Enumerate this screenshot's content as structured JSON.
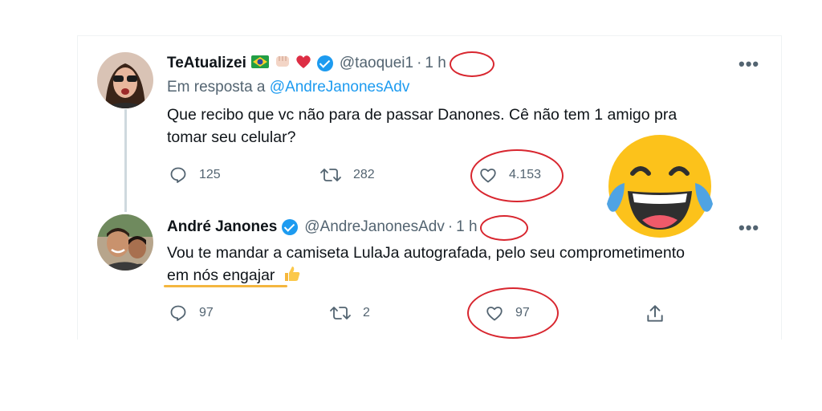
{
  "tweet1": {
    "name": "TeAtualizei",
    "handle": "@taoquei1",
    "time": "1 h",
    "reply_prefix": "Em resposta a",
    "reply_to": "@AndreJanonesAdv",
    "text_line1": "Que recibo que vc não para de passar Danones. Cê não tem 1 amigo pra",
    "text_line2": "tomar seu celular?",
    "replies": "125",
    "retweets": "282",
    "likes": "4.153"
  },
  "tweet2": {
    "name": "André Janones",
    "handle": "@AndreJanonesAdv",
    "time": "1 h",
    "text_line1": "Vou te mandar a camiseta LulaJa autografada, pelo seu comprometimento",
    "text_line2": "em nós engajar",
    "replies": "97",
    "retweets": "2",
    "likes": "97"
  },
  "more_label": "•••",
  "icons": [
    "reply-icon",
    "retweet-icon",
    "like-icon",
    "share-icon",
    "verified-icon",
    "brazil-flag-icon",
    "fist-icon",
    "heart-icon",
    "thumbs-up-icon",
    "laughing-crying-emoji"
  ],
  "colors": {
    "accent": "#1d9bf0",
    "annotation_red": "#d8262f",
    "annotation_underline": "#f4b63f",
    "muted": "#536471"
  }
}
